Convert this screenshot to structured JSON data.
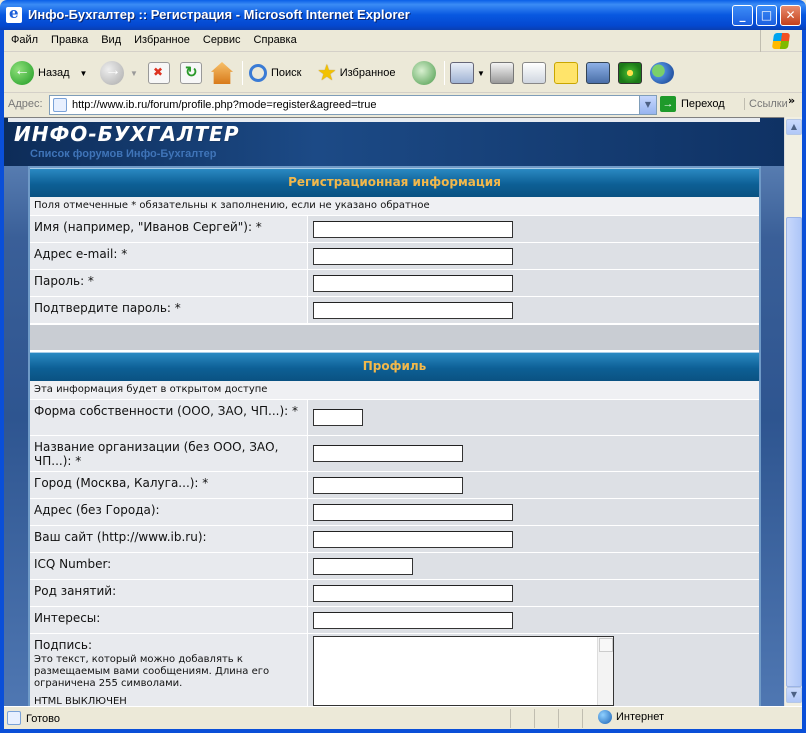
{
  "window": {
    "title": "Инфо-Бухгалтер :: Регистрация - Microsoft Internet Explorer",
    "minimize": "_",
    "maximize": "□",
    "close": "✕"
  },
  "menu": [
    "Файл",
    "Правка",
    "Вид",
    "Избранное",
    "Сервис",
    "Справка"
  ],
  "toolbar": {
    "back_label": "Назад",
    "search_label": "Поиск",
    "favorites_label": "Избранное"
  },
  "address": {
    "label": "Адрес:",
    "url": "http://www.ib.ru/forum/profile.php?mode=register&agreed=true",
    "go_label": "Переход",
    "links_label": "Ссылки",
    "chevron": "»"
  },
  "site": {
    "logo": "ИНФО-БУХГАЛТЕР",
    "breadcrumb": "Список форумов Инфо-Бухгалтер"
  },
  "registration": {
    "header": "Регистрационная информация",
    "note": "Поля отмеченные * обязательны к заполнению, если не указано обратное",
    "fields": [
      {
        "label": "Имя (например, \"Иванов Сергей\"): *",
        "value": ""
      },
      {
        "label": "Адрес e-mail: *",
        "value": ""
      },
      {
        "label": "Пароль: *",
        "value": ""
      },
      {
        "label": "Подтвердите пароль: *",
        "value": ""
      }
    ]
  },
  "profile": {
    "header": "Профиль",
    "note": "Эта информация будет в открытом доступе",
    "fields": [
      {
        "label": "Форма собственности (ООО, ЗАО, ЧП...): *",
        "value": ""
      },
      {
        "label": "Название организации (без ООО, ЗАО, ЧП...): *",
        "value": ""
      },
      {
        "label": "Город (Москва, Калуга...): *",
        "value": ""
      },
      {
        "label": "Адрес (без Города):",
        "value": ""
      },
      {
        "label": "Ваш сайт (http://www.ib.ru):",
        "value": ""
      },
      {
        "label": "ICQ Number:",
        "value": ""
      },
      {
        "label": "Род занятий:",
        "value": ""
      },
      {
        "label": "Интересы:",
        "value": ""
      }
    ],
    "signature": {
      "label": "Подпись:",
      "help": "Это текст, который можно добавлять к размещаемым вами сообщениям. Длина его ограничена 255 символами.",
      "html_status": "HTML ВЫКЛЮЧЕН",
      "value": ""
    }
  },
  "status": {
    "text": "Готово",
    "zone": "Интернет"
  }
}
